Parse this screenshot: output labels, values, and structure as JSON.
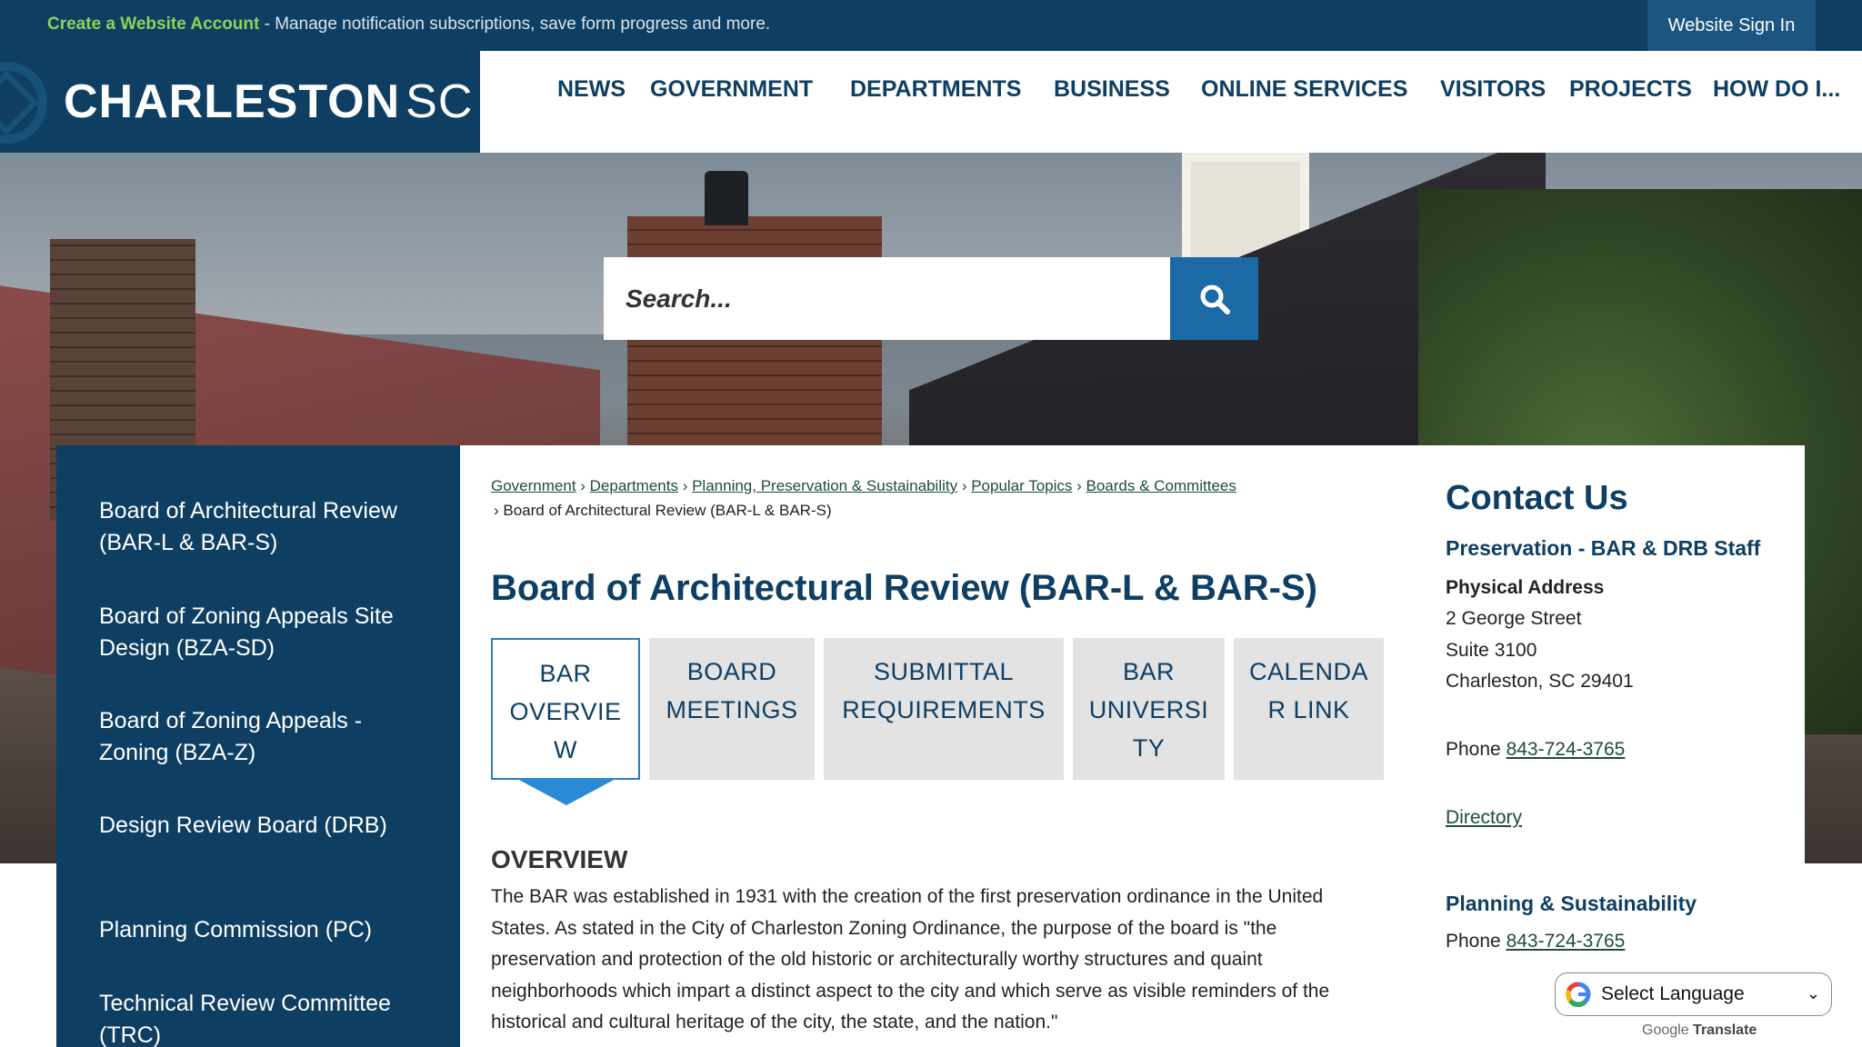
{
  "topbar": {
    "create_link": "Create a Website Account",
    "create_text": " - Manage notification subscriptions, save form progress and more.",
    "signin_label": "Website Sign In"
  },
  "logo": {
    "main": "CHARLESTON",
    "suffix": "SC"
  },
  "nav": {
    "items": [
      "NEWS",
      "GOVERNMENT",
      "DEPARTMENTS",
      "BUSINESS",
      "ONLINE SERVICES",
      "VISITORS",
      "PROJECTS",
      "HOW DO I..."
    ]
  },
  "search": {
    "placeholder": "Search..."
  },
  "sidebar": {
    "items": [
      "Board of Architectural Review (BAR-L & BAR-S)",
      "Board of Zoning Appeals Site Design (BZA-SD)",
      "Board of Zoning Appeals - Zoning (BZA-Z)",
      "Design Review Board (DRB)",
      "Planning Commission (PC)",
      "Technical Review Committee (TRC)"
    ]
  },
  "breadcrumb": {
    "links": [
      "Government",
      "Departments",
      "Planning, Preservation & Sustainability",
      "Popular Topics",
      "Boards & Committees"
    ],
    "current": "Board of Architectural Review (BAR-L & BAR-S)"
  },
  "page": {
    "title": "Board of Architectural Review (BAR-L & BAR-S)"
  },
  "tabs": [
    {
      "line1": "BAR",
      "line2": "OVERVIE",
      "line3": "W"
    },
    {
      "line1": "BOARD",
      "line2": "MEETINGS",
      "line3": ""
    },
    {
      "line1": "SUBMITTAL",
      "line2": "REQUIREMENTS",
      "line3": ""
    },
    {
      "line1": "BAR",
      "line2": "UNIVERSI",
      "line3": "TY"
    },
    {
      "line1": "CALENDA",
      "line2": "R LINK",
      "line3": ""
    }
  ],
  "overview": {
    "heading": "OVERVIEW",
    "text": "The BAR was established in 1931 with the creation of the first preservation ordinance in the United States. As stated in the City of Charleston Zoning Ordinance, the purpose of the board is \"the preservation and protection of the old historic or architecturally worthy structures and quaint neighborhoods which impart a distinct aspect to the city and which serve as visible reminders of the historical and cultural heritage of the city, the state, and the nation.\""
  },
  "contact": {
    "title": "Contact Us",
    "group1": "Preservation - BAR & DRB Staff",
    "address_label": "Physical Address",
    "address1": "2 George Street",
    "address2": "Suite 3100",
    "address3": "Charleston, SC 29401",
    "phone_label": "Phone ",
    "phone1": "843-724-3765",
    "directory": "Directory",
    "group2": "Planning & Sustainability",
    "phone2": "843-724-3765"
  },
  "translate": {
    "select_label": "Select Language",
    "powered_google": "Google",
    "powered_translate": "Translate"
  },
  "colors": {
    "navy": "#0e3f63",
    "accent_blue": "#1b6aa5",
    "create_green": "#8fd15a"
  }
}
